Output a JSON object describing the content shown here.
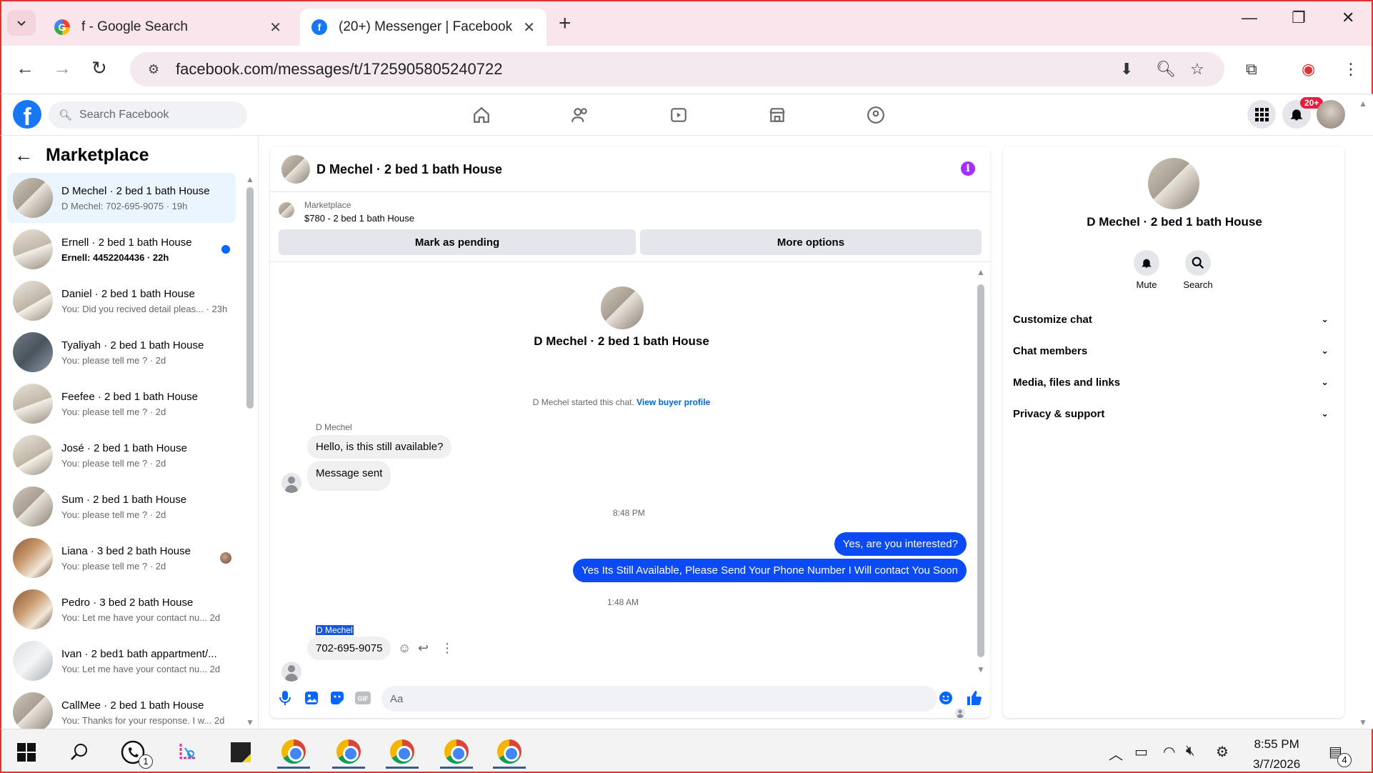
{
  "browser": {
    "tabs": [
      {
        "title": "f - Google Search",
        "icon": "google-icon"
      },
      {
        "title": "(20+) Messenger | Facebook",
        "icon": "facebook-icon",
        "active": true
      }
    ],
    "url": "facebook.com/messages/t/1725905805240722"
  },
  "fb": {
    "search_placeholder": "Search Facebook",
    "notifications_badge": "20+"
  },
  "sidebar": {
    "title": "Marketplace",
    "conversations": [
      {
        "name": "D Mechel · 2 bed 1 bath House",
        "preview": "D Mechel: 702-695-9075 · 19h",
        "active": true
      },
      {
        "name": "Ernell · 2 bed 1 bath House",
        "preview": "Ernell: 4452204436 · 22h",
        "unread": true
      },
      {
        "name": "Daniel · 2 bed 1 bath House",
        "preview": "You: Did you recived detail pleas... · 23h"
      },
      {
        "name": "Tyaliyah · 2 bed 1 bath House",
        "preview": "You: please tell me ? · 2d"
      },
      {
        "name": "Feefee · 2 bed 1 bath House",
        "preview": "You: please tell me ? · 2d"
      },
      {
        "name": "José · 2 bed 1 bath House",
        "preview": "You: please tell me ? · 2d"
      },
      {
        "name": "Sum · 2 bed 1 bath House",
        "preview": "You: please tell me ? · 2d"
      },
      {
        "name": "Liana · 3 bed 2 bath House",
        "preview": "You: please tell me ? · 2d"
      },
      {
        "name": "Pedro · 3 bed 2 bath House",
        "preview": "You: Let me have your contact nu...   2d"
      },
      {
        "name": "Ivan · 2 bed1 bath appartment/...",
        "preview": "You: Let me have your contact nu...   2d"
      },
      {
        "name": "CallMee · 2 bed 1 bath House",
        "preview": "You: Thanks for your response. I w...  2d"
      }
    ]
  },
  "chat": {
    "title": "D Mechel · 2 bed 1 bath House",
    "marketplace_label": "Marketplace",
    "listing": "$780 - 2 bed 1 bath House",
    "mark_pending": "Mark as pending",
    "more_options": "More options",
    "intro_title": "D Mechel · 2 bed 1 bath House",
    "started_text": "D Mechel started this chat.",
    "view_profile": "View buyer profile",
    "sender_name": "D Mechel",
    "msg1": "Hello, is this still available?",
    "msg2": "Message sent",
    "time1": "8:48 PM",
    "out1": "Yes, are you interested?",
    "out2": "Yes Its Still Available, Please Send Your Phone Number I Will contact You Soon",
    "time2": "1:48 AM",
    "sender_name2": "D Mechel",
    "msg3": "702-695-9075",
    "composer_placeholder": "Aa"
  },
  "details": {
    "title": "D Mechel · 2 bed 1 bath House",
    "mute": "Mute",
    "search": "Search",
    "rows": [
      "Customize chat",
      "Chat members",
      "Media, files and links",
      "Privacy & support"
    ]
  },
  "taskbar": {
    "time": "8:55 PM",
    "date": "3/7/2026",
    "whatsapp_badge": "1",
    "notif_badge": "4"
  },
  "colors": {
    "brand": "#1877f2",
    "outgoing_bubble": "#0a4bf5",
    "active_conv": "#ebf5ff",
    "tab_strip": "#fbe5ec"
  }
}
